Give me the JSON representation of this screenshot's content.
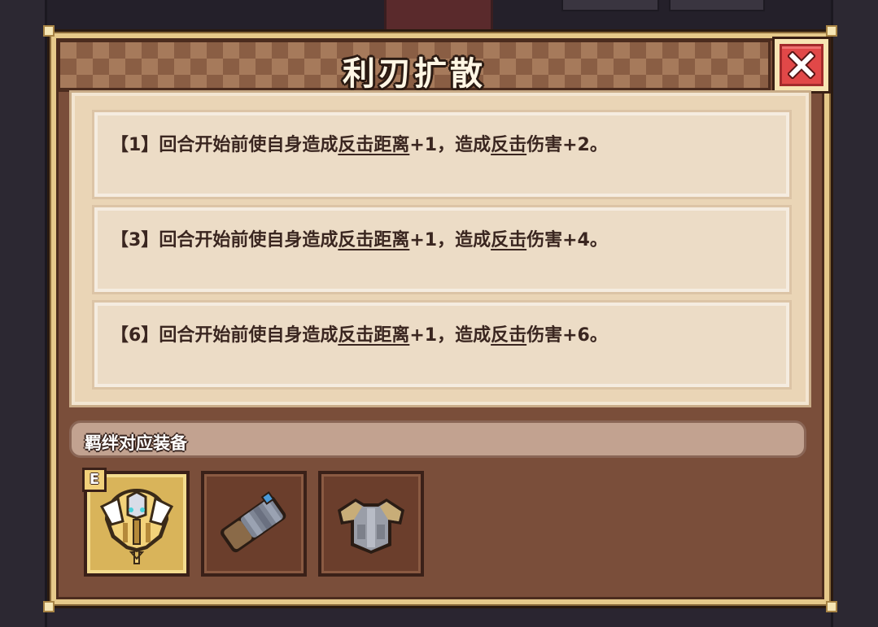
{
  "dialog": {
    "title": "利刃扩散",
    "close_icon": "close-x-icon"
  },
  "effects": [
    {
      "tier": "【1】",
      "pre": "回合开始前使自身造成",
      "kw1": "反击距离",
      "mid": "+1，造成",
      "kw2": "反击",
      "post": "伤害+2。"
    },
    {
      "tier": "【3】",
      "pre": "回合开始前使自身造成",
      "kw1": "反击距离",
      "mid": "+1，造成",
      "kw2": "反击",
      "post": "伤害+4。"
    },
    {
      "tier": "【6】",
      "pre": "回合开始前使自身造成",
      "kw1": "反击距离",
      "mid": "+1，造成",
      "kw2": "反击",
      "post": "伤害+6。"
    }
  ],
  "equipment": {
    "header": "羁绊对应装备",
    "items": [
      {
        "icon": "winged-helmet-icon",
        "badge": "E",
        "selected": true
      },
      {
        "icon": "gauntlet-icon",
        "selected": false
      },
      {
        "icon": "chest-armor-icon",
        "selected": false
      }
    ]
  },
  "colors": {
    "frame": "#e6c98a",
    "panel": "#ead5b6",
    "close": "#e14848",
    "selected_slot": "#d9b45a"
  }
}
